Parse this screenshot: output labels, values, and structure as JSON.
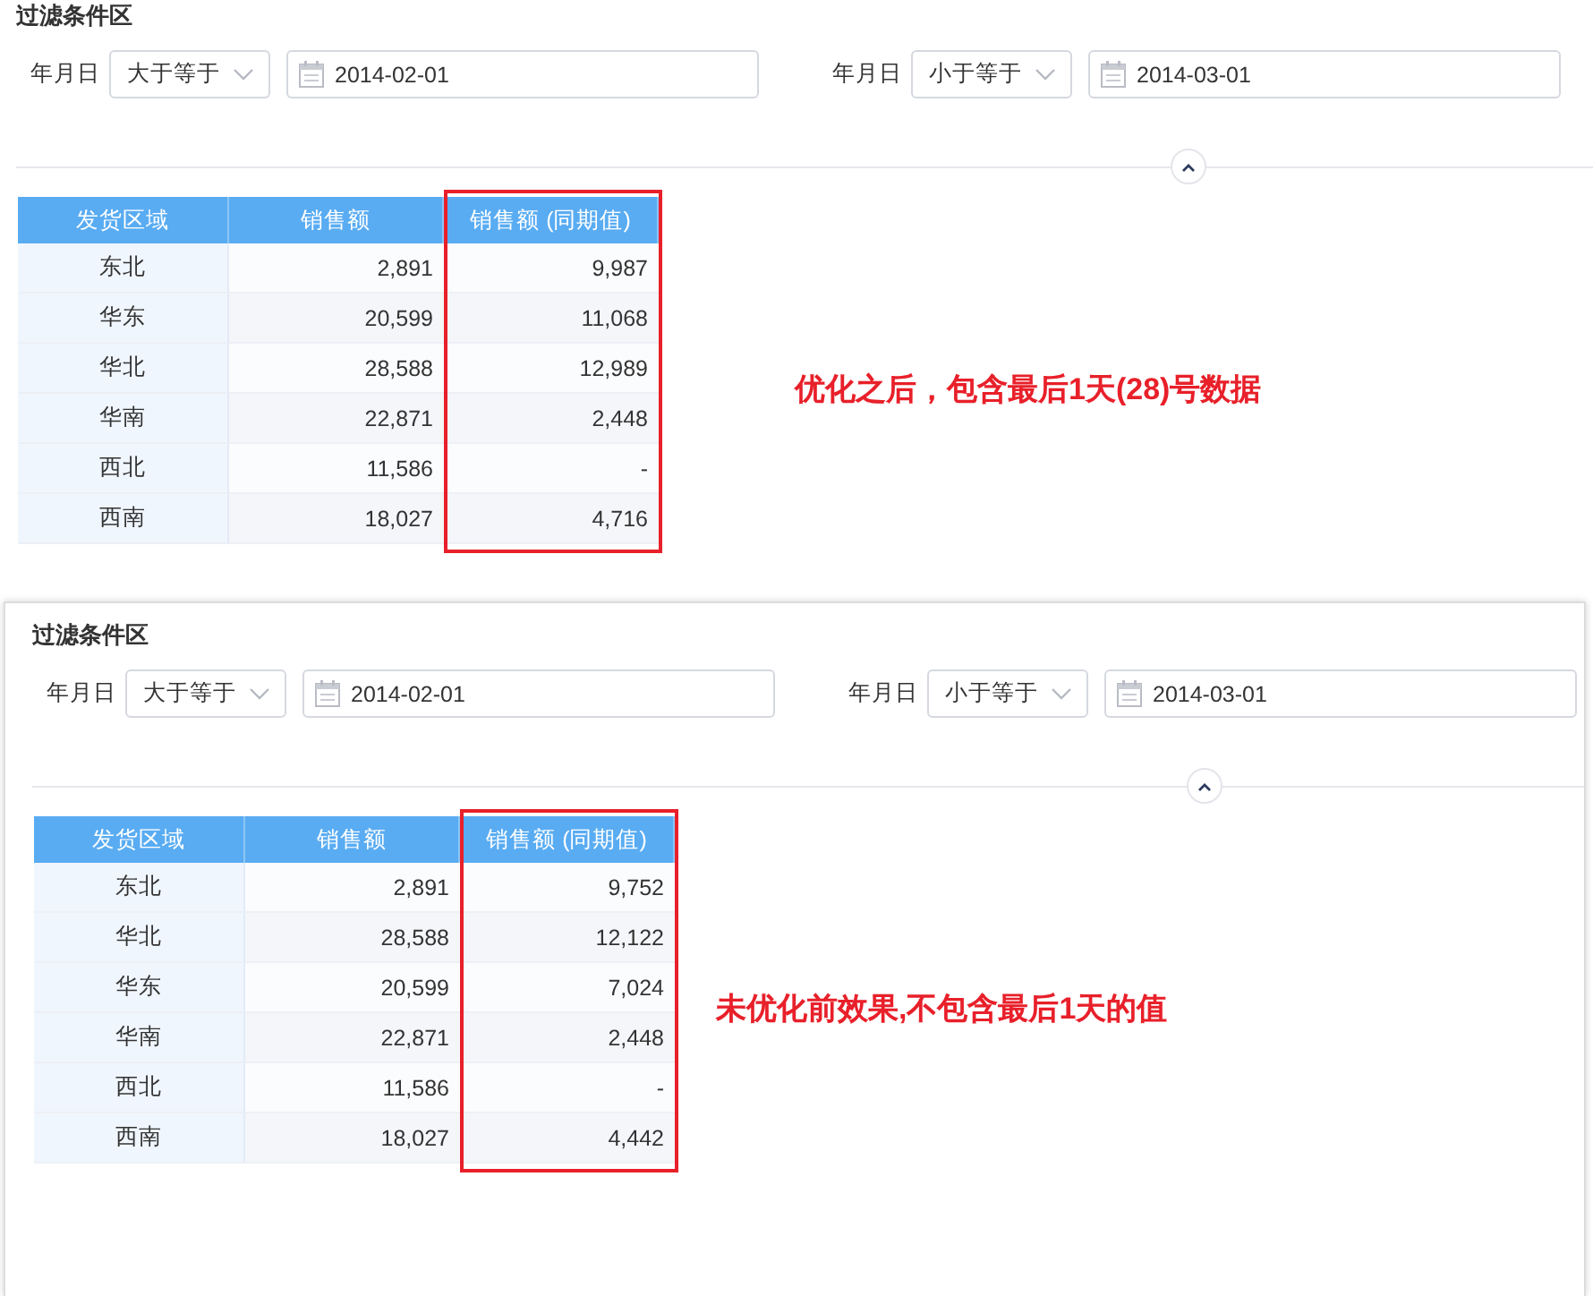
{
  "panels": [
    {
      "title": "过滤条件区",
      "filters": [
        {
          "label": "年月日",
          "operator": "大于等于",
          "date": "2014-02-01"
        },
        {
          "label": "年月日",
          "operator": "小于等于",
          "date": "2014-03-01"
        }
      ],
      "table": {
        "columns": [
          "发货区域",
          "销售额",
          "销售额 (同期值)"
        ],
        "rows": [
          [
            "东北",
            "2,891",
            "9,987"
          ],
          [
            "华东",
            "20,599",
            "11,068"
          ],
          [
            "华北",
            "28,588",
            "12,989"
          ],
          [
            "华南",
            "22,871",
            "2,448"
          ],
          [
            "西北",
            "11,586",
            "-"
          ],
          [
            "西南",
            "18,027",
            "4,716"
          ]
        ]
      },
      "annotation": "优化之后，包含最后1天(28)号数据"
    },
    {
      "title": "过滤条件区",
      "filters": [
        {
          "label": "年月日",
          "operator": "大于等于",
          "date": "2014-02-01"
        },
        {
          "label": "年月日",
          "operator": "小于等于",
          "date": "2014-03-01"
        }
      ],
      "table": {
        "columns": [
          "发货区域",
          "销售额",
          "销售额 (同期值)"
        ],
        "rows": [
          [
            "东北",
            "2,891",
            "9,752"
          ],
          [
            "华北",
            "28,588",
            "12,122"
          ],
          [
            "华东",
            "20,599",
            "7,024"
          ],
          [
            "华南",
            "22,871",
            "2,448"
          ],
          [
            "西北",
            "11,586",
            "-"
          ],
          [
            "西南",
            "18,027",
            "4,442"
          ]
        ]
      },
      "annotation": "未优化前效果,不包含最后1天的值"
    }
  ]
}
